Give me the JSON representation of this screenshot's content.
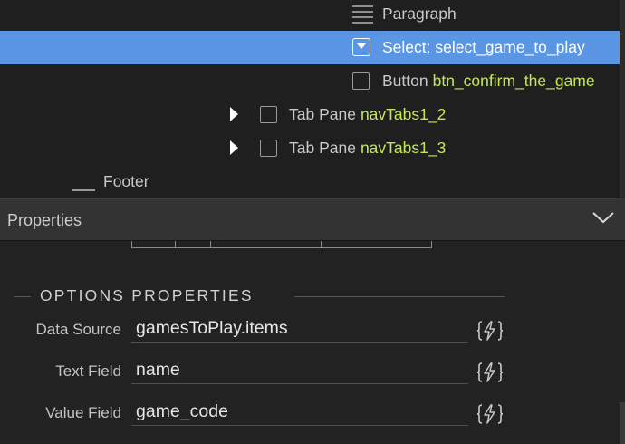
{
  "tree": {
    "paragraph": {
      "label": "Paragraph"
    },
    "select": {
      "label": "Select: select_game_to_play"
    },
    "button": {
      "type": "Button",
      "name": "btn_confirm_the_game"
    },
    "tab_pane_2": {
      "type": "Tab Pane",
      "name": "navTabs1_2"
    },
    "tab_pane_3": {
      "type": "Tab Pane",
      "name": "navTabs1_3"
    },
    "footer": {
      "label": "Footer"
    }
  },
  "properties": {
    "title": "Properties",
    "section_title": "OPTIONS PROPERTIES",
    "fields": [
      {
        "label": "Data Source",
        "value": "gamesToPlay.items"
      },
      {
        "label": "Text Field",
        "value": "name"
      },
      {
        "label": "Value Field",
        "value": "game_code"
      }
    ]
  },
  "colors": {
    "selection": "#5b96e4",
    "component_name": "#c4e65a",
    "background": "#222222"
  }
}
